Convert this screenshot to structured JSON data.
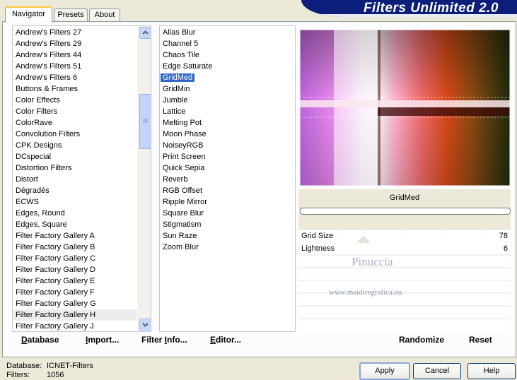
{
  "title": "Filters Unlimited 2.0",
  "tabs": [
    {
      "label": "Navigator",
      "active": true
    },
    {
      "label": "Presets",
      "active": false
    },
    {
      "label": "About",
      "active": false
    }
  ],
  "categories": [
    "Andrew's Filters 27",
    "Andrew's Filters 29",
    "Andrew's Filters 44",
    "Andrew's Filters 51",
    "Andrew's Filters 6",
    "Buttons & Frames",
    "Color Effects",
    "Color Filters",
    "ColorRave",
    "Convolution Filters",
    "CPK Designs",
    "DCspecial",
    "Distortion Filters",
    "Distort",
    "Dégradés",
    "ECWS",
    "Edges, Round",
    "Edges, Square",
    "Filter Factory Gallery A",
    "Filter Factory Gallery B",
    "Filter Factory Gallery C",
    "Filter Factory Gallery D",
    "Filter Factory Gallery E",
    "Filter Factory Gallery F",
    "Filter Factory Gallery G",
    "Filter Factory Gallery H",
    "Filter Factory Gallery J"
  ],
  "selected_category": "Filter Factory Gallery H",
  "filters": [
    "Alias Blur",
    "Channel 5",
    "Chaos Tile",
    "Edge Saturate",
    "GridMed",
    "GridMin",
    "Jumble",
    "Lattice",
    "Melting Pot",
    "Moon Phase",
    "NoiseyRGB",
    "Print Screen",
    "Quick Sepia",
    "Reverb",
    "RGB Offset",
    "Ripple Mirror",
    "Square Blur",
    "Stigmatism",
    "Sun Raze",
    "Zoom Blur"
  ],
  "selected_filter": "GridMed",
  "filter_name": "GridMed",
  "params": [
    {
      "label": "Grid Size",
      "value": "78"
    },
    {
      "label": "Lightness",
      "value": "6"
    }
  ],
  "watermark": {
    "line1": "Pinuccia",
    "line2": "www.maidiregrafica.eu"
  },
  "toolbar": {
    "database": "Database",
    "import": "Import...",
    "filter_info": "Filter Info...",
    "editor": "Editor...",
    "randomize": "Randomize",
    "reset": "Reset"
  },
  "status": {
    "database_label": "Database:",
    "database_value": "ICNET-Filters",
    "filters_label": "Filters:",
    "filters_value": "1056"
  },
  "buttons": {
    "apply": "Apply",
    "cancel": "Cancel",
    "help": "Help"
  },
  "colors": {
    "banner": "#0b1f7a",
    "selection": "#316ac5",
    "tab_accent": "#ffc83c"
  }
}
